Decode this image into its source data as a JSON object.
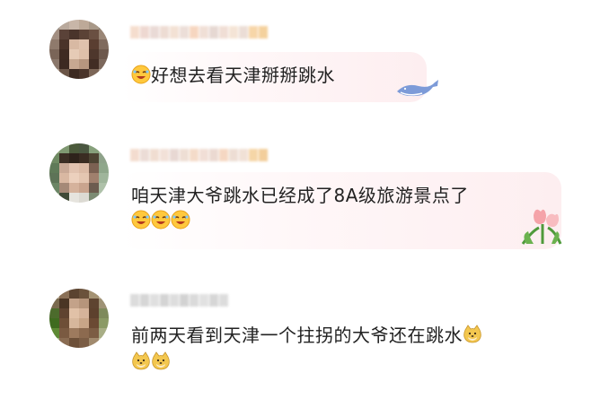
{
  "comments": [
    {
      "text": "好想去看天津掰掰跳水",
      "leading_emoji": "rolling-laugh-emoji",
      "trailing_emojis": [],
      "second_line_emojis": [],
      "decoration": "whale-icon"
    },
    {
      "text": "咱天津大爷跳水已经成了8A级旅游景点了",
      "leading_emoji": "",
      "trailing_emojis": [],
      "second_line_emojis": [
        "rolling-laugh-emoji",
        "rolling-laugh-emoji",
        "rolling-laugh-emoji"
      ],
      "decoration": "tulip-icon"
    },
    {
      "text": "前两天看到天津一个拄拐的大爷还在跳水",
      "leading_emoji": "",
      "trailing_emojis": [
        "doge-emoji"
      ],
      "second_line_emojis": [
        "doge-emoji",
        "doge-emoji"
      ],
      "decoration": ""
    }
  ],
  "colors": {
    "text": "#222222",
    "bubble_tint": "#fdeef0"
  }
}
